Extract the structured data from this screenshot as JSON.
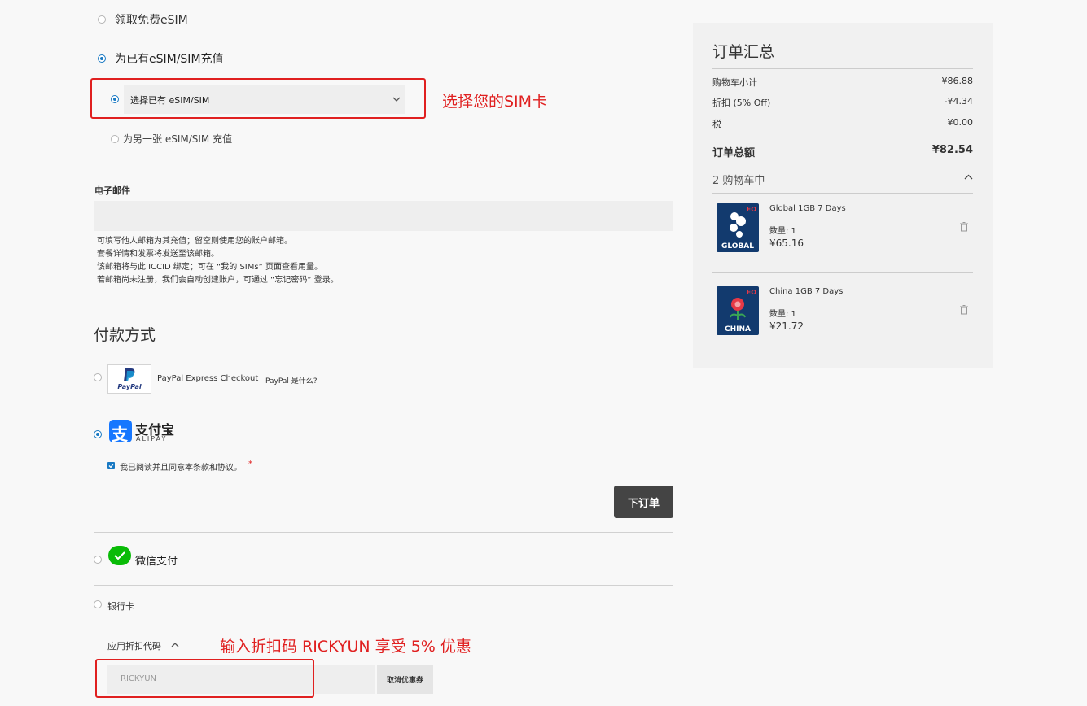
{
  "options": {
    "free_esim": "领取免费eSIM",
    "topup_existing": "为已有eSIM/SIM充值",
    "select_existing": "选择已有 eSIM/SIM",
    "topup_other": "为另一张 eSIM/SIM 充值"
  },
  "email": {
    "label": "电子邮件",
    "value": "",
    "notes": [
      "可填写他人邮箱为其充值；留空则使用您的账户邮箱。",
      "套餐详情和发票将发送至该邮箱。",
      "该邮箱将与此 ICCID 绑定；可在 “我的 SIMs” 页面查看用量。",
      "若邮箱尚未注册，我们会自动创建账户，可通过 “忘记密码” 登录。"
    ]
  },
  "payment": {
    "title": "付款方式",
    "paypal_label": "PayPal Express Checkout",
    "paypal_logo": "PayPal",
    "paypal_what": "PayPal 是什么?",
    "alipay_cn": "支付宝",
    "alipay_en": "ALIPAY",
    "agree_text": "我已阅读并且同意本条款和协议。",
    "required_mark": "*",
    "place_order": "下订单",
    "wechat_label": "微信支付",
    "bank_label": "银行卡"
  },
  "discount": {
    "label": "应用折扣代码",
    "code_value": "RICKYUN",
    "cancel_button": "取消优惠券"
  },
  "annotations": {
    "select_sim": "选择您的SIM卡",
    "enter_code": "输入折扣码 RICKYUN 享受 5% 优惠"
  },
  "summary": {
    "title": "订单汇总",
    "subtotal_label": "购物车小计",
    "subtotal_value": "¥86.88",
    "discount_label": "折扣 (5% Off)",
    "discount_value": "-¥4.34",
    "tax_label": "税",
    "tax_value": "¥0.00",
    "total_label": "订单总额",
    "total_value": "¥82.54",
    "cart_count": "2 购物车中",
    "items": [
      {
        "name": "Global 1GB 7 Days",
        "qty": "数量: 1",
        "price": "¥65.16",
        "card_label": "GLOBAL",
        "badge": "EO"
      },
      {
        "name": "China 1GB 7 Days",
        "qty": "数量: 1",
        "price": "¥21.72",
        "card_label": "CHINA",
        "badge": "EO"
      }
    ]
  },
  "colors": {
    "accent": "#1979c3",
    "annotation": "#e02020",
    "order_button": "#444444"
  }
}
